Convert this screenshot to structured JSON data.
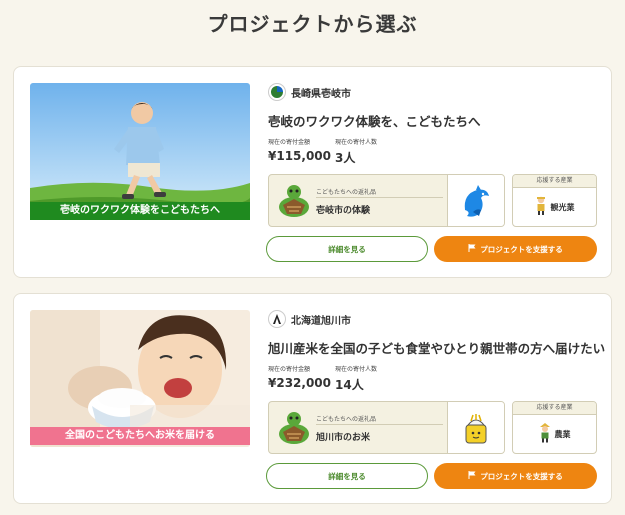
{
  "page": {
    "heading": "プロジェクトから選ぶ"
  },
  "labels": {
    "amount": "現在の寄付金額",
    "donors": "現在の寄付人数",
    "reward": "こどもたちへの返礼品",
    "industry": "応援する産業",
    "detail_button": "詳細を見る",
    "support_button": "プロジェクトを支援する"
  },
  "projects": [
    {
      "municipality": "長崎県壱岐市",
      "title": "壱岐のワクワク体験を、こどもたちへ",
      "image_caption": "壱岐のワクワク体験をこどもたちへ",
      "amount": "¥115,000",
      "donors": "3人",
      "reward": "壱岐市の体験",
      "industry": "観光業",
      "caption_color": "#1f8a1f"
    },
    {
      "municipality": "北海道旭川市",
      "title": "旭川産米を全国の子ども食堂やひとり親世帯の方へ届けたい",
      "image_caption": "全国のこどもたちへお米を届ける",
      "amount": "¥232,000",
      "donors": "14人",
      "reward": "旭川市のお米",
      "industry": "農業",
      "caption_color": "#f0738f"
    }
  ],
  "colors": {
    "accent_green": "#4b8a2c",
    "accent_orange": "#ee8511",
    "background": "#f8f5ec"
  },
  "icons": [
    "municipality-logo-icon",
    "turtle-mascot-icon",
    "dolphin-icon",
    "rice-bag-icon",
    "tour-guide-icon",
    "farmer-icon",
    "flag-icon"
  ]
}
